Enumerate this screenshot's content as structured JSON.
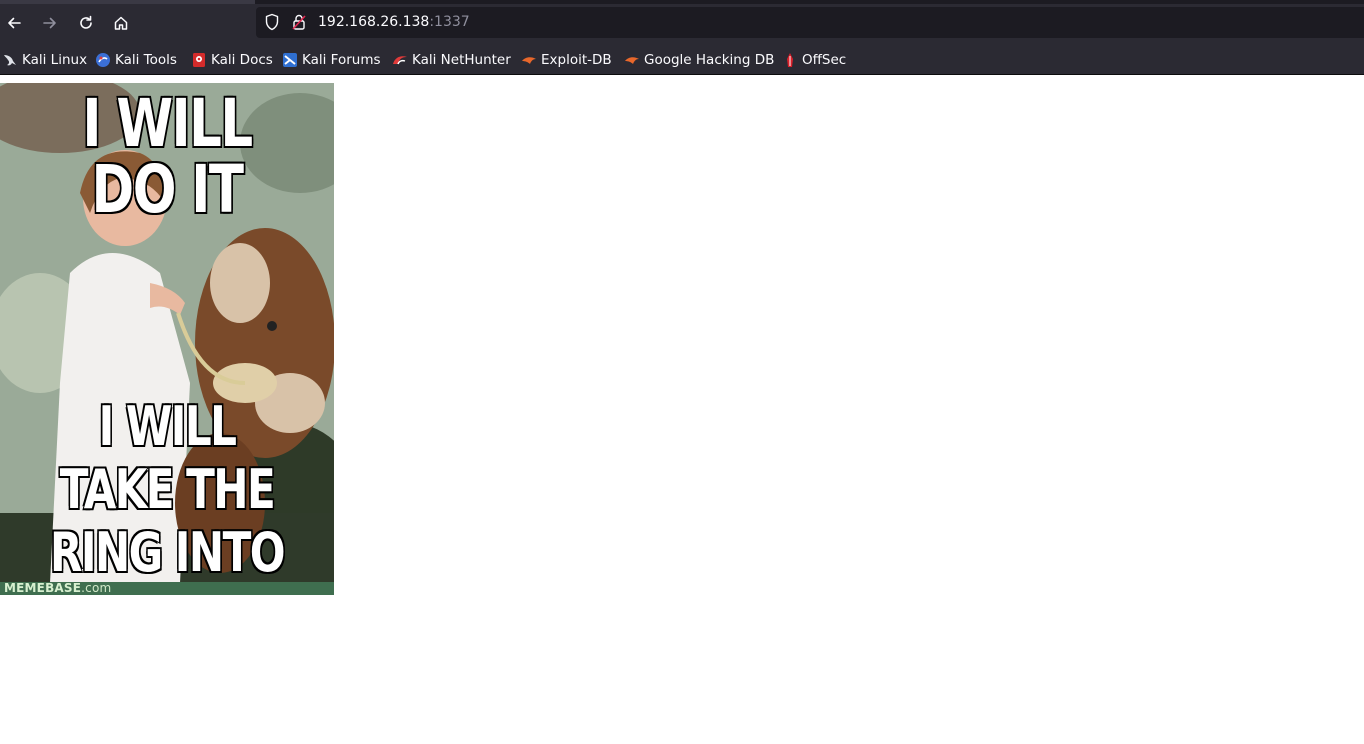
{
  "browser": {
    "url_host": "192.168.26.138",
    "url_port": ":1337",
    "icons": {
      "back": "back-arrow-icon",
      "forward": "forward-arrow-icon",
      "reload": "reload-icon",
      "home": "home-icon",
      "shield": "tracking-shield-icon",
      "lock": "insecure-lock-icon"
    }
  },
  "bookmarks": [
    {
      "label": "Kali Linux",
      "icon": "kali-dragon-icon"
    },
    {
      "label": "Kali Tools",
      "icon": "kali-tools-icon"
    },
    {
      "label": "Kali Docs",
      "icon": "kali-docs-icon"
    },
    {
      "label": "Kali Forums",
      "icon": "kali-forums-icon"
    },
    {
      "label": "Kali NetHunter",
      "icon": "kali-nethunter-icon"
    },
    {
      "label": "Exploit-DB",
      "icon": "exploit-db-icon"
    },
    {
      "label": "Google Hacking DB",
      "icon": "ghdb-icon"
    },
    {
      "label": "OffSec",
      "icon": "offsec-icon"
    }
  ],
  "page": {
    "meme": {
      "top_text": "I WILL DO IT",
      "bottom_text": "I WILL TAKE THE\nRING INTO\nMORDOR",
      "watermark_brand": "MEMEBASE",
      "watermark_domain": ".com"
    }
  },
  "colors": {
    "chrome_bg": "#2b2a33",
    "urlbar_bg": "#1c1b22",
    "page_bg": "#ffffff"
  }
}
